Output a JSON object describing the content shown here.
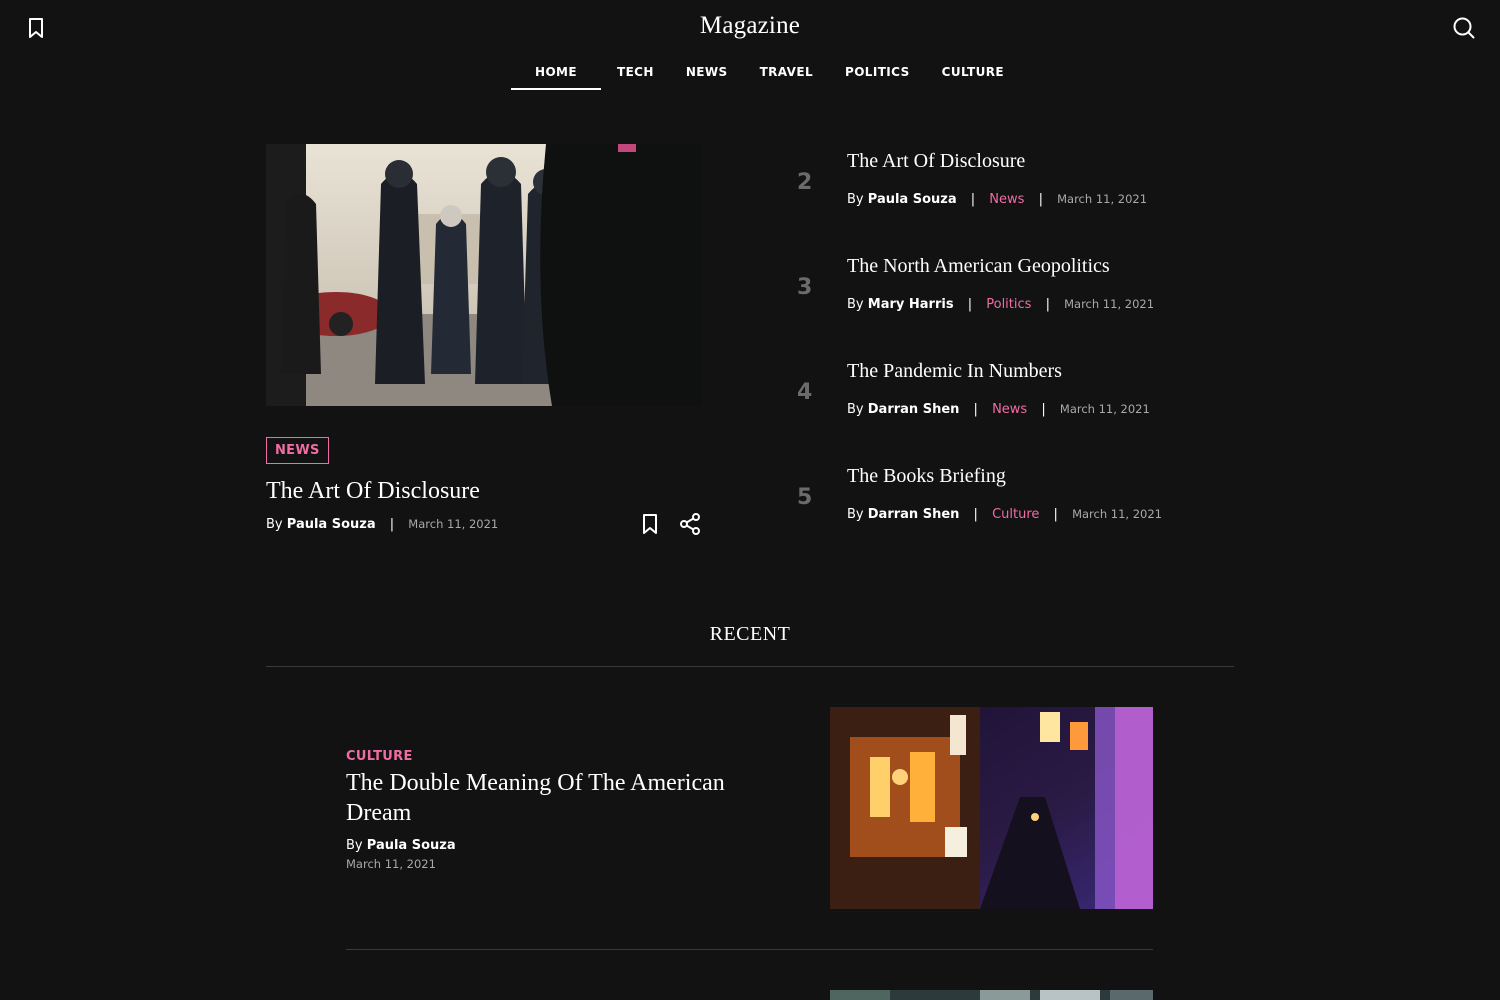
{
  "header": {
    "brand": "Magazine",
    "left_icon": "bookmark-icon",
    "right_icon": "search-icon"
  },
  "nav": {
    "items": [
      {
        "label": "HOME",
        "active": true
      },
      {
        "label": "TECH"
      },
      {
        "label": "NEWS"
      },
      {
        "label": "TRAVEL"
      },
      {
        "label": "POLITICS"
      },
      {
        "label": "CULTURE"
      }
    ]
  },
  "featured": {
    "tag": "NEWS",
    "title": "The Art Of Disclosure",
    "by": "By",
    "author": "Paula Souza",
    "separator": "|",
    "date": "March 11, 2021",
    "actions": [
      "bookmark-icon",
      "share-icon"
    ]
  },
  "ranked": [
    {
      "rank": "2",
      "title": "The Art Of Disclosure",
      "by": "By",
      "author": "Paula Souza",
      "category": "News",
      "date": "March 11, 2021"
    },
    {
      "rank": "3",
      "title": "The North American Geopolitics",
      "by": "By",
      "author": "Mary Harris",
      "category": "Politics",
      "date": "March 11, 2021"
    },
    {
      "rank": "4",
      "title": "The Pandemic In Numbers",
      "by": "By",
      "author": "Darran Shen",
      "category": "News",
      "date": "March 11, 2021"
    },
    {
      "rank": "5",
      "title": "The Books Briefing",
      "by": "By",
      "author": "Darran Shen",
      "category": "Culture",
      "date": "March 11, 2021"
    }
  ],
  "recent": {
    "heading": "RECENT",
    "items": [
      {
        "category": "CULTURE",
        "title": "The Double Meaning Of The American Dream",
        "by": "By",
        "author": "Paula Souza",
        "date": "March 11, 2021"
      }
    ]
  },
  "colors": {
    "background": "#121212",
    "accent": "#f06ca5",
    "muted": "#a9a9a9",
    "rank": "#6b6b6b"
  }
}
